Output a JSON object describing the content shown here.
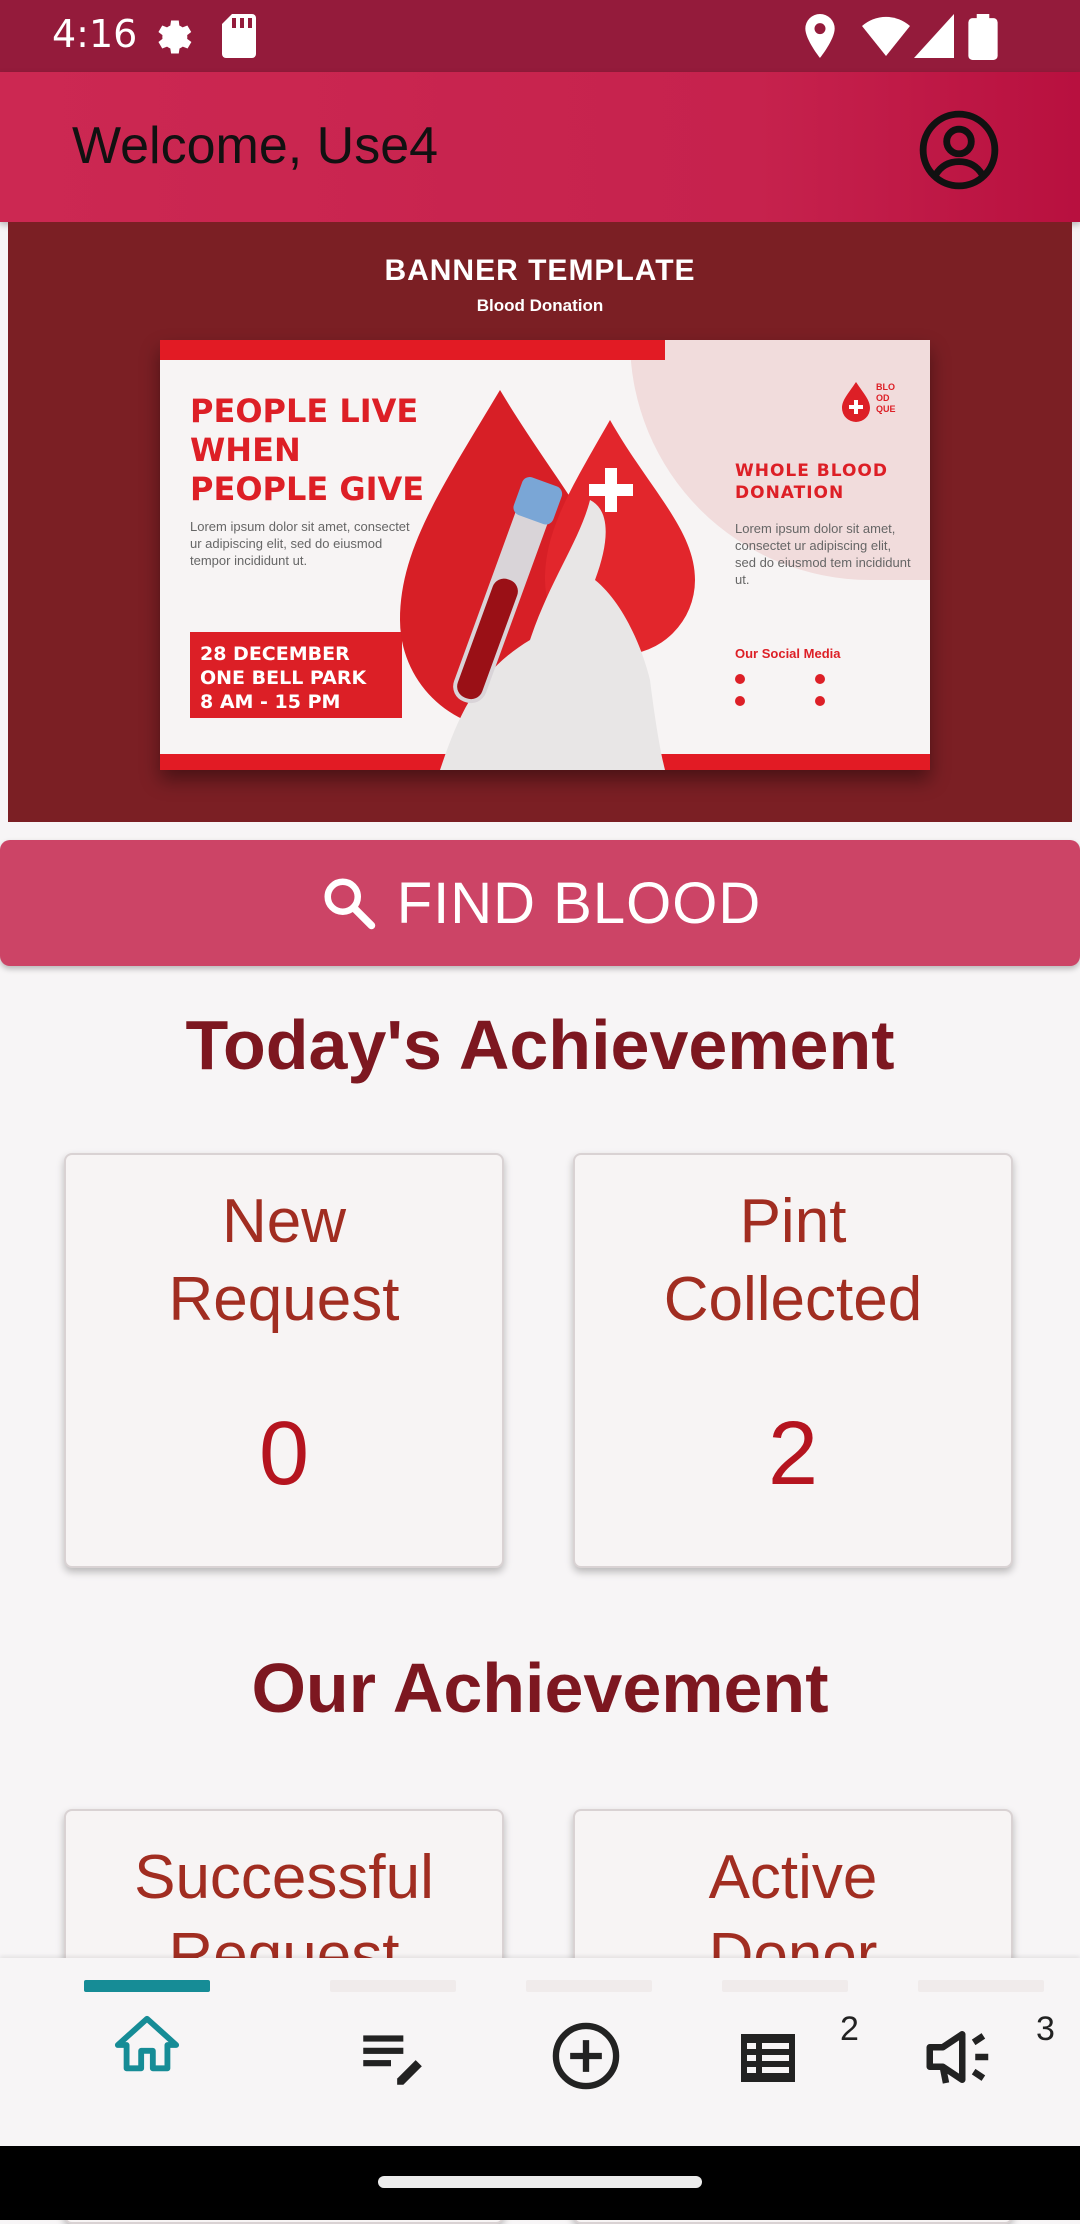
{
  "status_bar": {
    "time": "4:16",
    "icons": [
      "settings-gear-icon",
      "sd-card-icon",
      "location-icon",
      "wifi-icon",
      "signal-icon",
      "battery-icon"
    ]
  },
  "app_bar": {
    "title": "Welcome, Use4",
    "profile_icon": "account-circle-icon",
    "background": "#c6224d"
  },
  "banner": {
    "heading": "BANNER TEMPLATE",
    "subheading": "Blood Donation",
    "headline_lines": [
      "PEOPLE LIVE",
      "WHEN",
      "PEOPLE GIVE"
    ],
    "lorem_left": "Lorem ipsum dolor sit amet, consectet ur adipiscing elit, sed do eiusmod tempor incididunt ut.",
    "date_lines": [
      "28 DECEMBER",
      "ONE BELL PARK",
      "8 AM - 15 PM"
    ],
    "right_title_lines": [
      "WHOLE BLOOD",
      "DONATION"
    ],
    "lorem_right": "Lorem ipsum dolor sit amet, consectet ur adipiscing elit, sed do eiusmod tem incididunt ut.",
    "social_label": "Our Social Media",
    "logo_text": "BLO OD QUE"
  },
  "find_button": {
    "label": "FIND BLOOD",
    "icon": "search-icon",
    "color": "#cc4466"
  },
  "today": {
    "title": "Today's Achievement",
    "cards": [
      {
        "label_lines": [
          "New",
          "Request"
        ],
        "value": "0"
      },
      {
        "label_lines": [
          "Pint",
          "Collected"
        ],
        "value": "2"
      }
    ]
  },
  "our": {
    "title": "Our Achievement",
    "cards": [
      {
        "label_lines": [
          "Successful",
          "Request"
        ]
      },
      {
        "label_lines": [
          "Active",
          "Donor"
        ]
      }
    ]
  },
  "bottom_nav": {
    "items": [
      {
        "icon": "home-icon",
        "active": true
      },
      {
        "icon": "edit-list-icon"
      },
      {
        "icon": "add-circle-icon"
      },
      {
        "icon": "list-icon",
        "badge": "2"
      },
      {
        "icon": "campaign-icon",
        "badge": "3"
      }
    ],
    "active_color": "#168c96"
  }
}
